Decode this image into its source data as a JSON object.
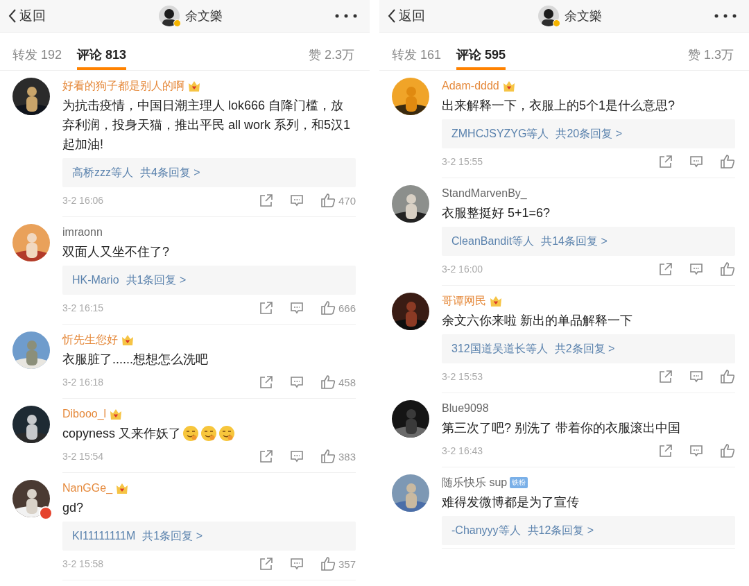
{
  "panels": [
    {
      "header": {
        "back": "返回",
        "title": "余文樂",
        "verified": true
      },
      "tabs": [
        {
          "label": "转发 192",
          "selected": false
        },
        {
          "label": "评论 813",
          "selected": true
        },
        {
          "label": "赞 2.3万",
          "selected": false
        }
      ],
      "comments": [
        {
          "username": "好看的狗子都是别人的啊",
          "vip": true,
          "avatar_badge": false,
          "text": "为抗击疫情，中国日潮主理人 lok666 自降门槛，放弃利润，投身天猫，推出平民 all work 系列，和5汉1起加油!",
          "replies": {
            "names": "高桥zzz等人",
            "total": "共4条回复 >"
          },
          "time": "3-2 16:06",
          "likes": "470"
        },
        {
          "username": "imraonn",
          "vip": false,
          "avatar_badge": false,
          "text": "双面人又坐不住了?",
          "replies": {
            "names": "HK-Mario",
            "total": "共1条回复 >"
          },
          "time": "3-2 16:15",
          "likes": "666"
        },
        {
          "username": "忻先生您好",
          "vip": true,
          "avatar_badge": false,
          "text": "衣服脏了......想想怎么洗吧",
          "time": "3-2 16:18",
          "likes": "458"
        },
        {
          "username": "Dibooo_l",
          "vip": true,
          "avatar_badge": false,
          "text": "copyness 又来作妖了",
          "emojis": [
            {
              "kind": "smirk"
            },
            {
              "kind": "smirk"
            },
            {
              "kind": "smirk"
            }
          ],
          "time": "3-2 15:54",
          "likes": "383"
        },
        {
          "username": "NanGGe_",
          "vip": true,
          "avatar_badge": true,
          "text": "gd?",
          "replies": {
            "names": "KI11111111M",
            "total": "共1条回复 >"
          },
          "time": "3-2 15:58",
          "likes": "357"
        }
      ]
    },
    {
      "header": {
        "back": "返回",
        "title": "余文樂",
        "verified": true
      },
      "tabs": [
        {
          "label": "转发 161",
          "selected": false
        },
        {
          "label": "评论 595",
          "selected": true
        },
        {
          "label": "赞 1.3万",
          "selected": false
        }
      ],
      "comments": [
        {
          "username": "Adam-dddd",
          "vip": true,
          "avatar_badge": false,
          "text": "出来解释一下，衣服上的5个1是什么意思?",
          "replies": {
            "names": "ZMHCJSYZYG等人",
            "total": "共20条回复 >"
          },
          "time": "3-2 15:55"
        },
        {
          "username": "StandMarvenBy_",
          "vip": false,
          "avatar_badge": false,
          "text": "衣服整挺好 5+1=6?",
          "replies": {
            "names": "CleanBandit等人",
            "total": "共14条回复 >"
          },
          "time": "3-2 16:00"
        },
        {
          "username": "哥谭网民",
          "vip": true,
          "avatar_badge": false,
          "text": "余文六你来啦 新出的单品解释一下",
          "replies": {
            "names": "312国道吴道长等人",
            "total": "共2条回复 >"
          },
          "time": "3-2 15:53"
        },
        {
          "username": "Blue9098",
          "vip": false,
          "avatar_badge": false,
          "text": "第三次了吧? 别洗了 带着你的衣服滚出中国",
          "time": "3-2 16:43"
        },
        {
          "username": "随乐快乐 sup",
          "vip": false,
          "avatar_badge": false,
          "fan_badge": "铁粉",
          "text": "难得发微博都是为了宣传",
          "replies": {
            "names": "-Chanyyy等人",
            "total": "共12条回复 >"
          }
        }
      ]
    }
  ]
}
